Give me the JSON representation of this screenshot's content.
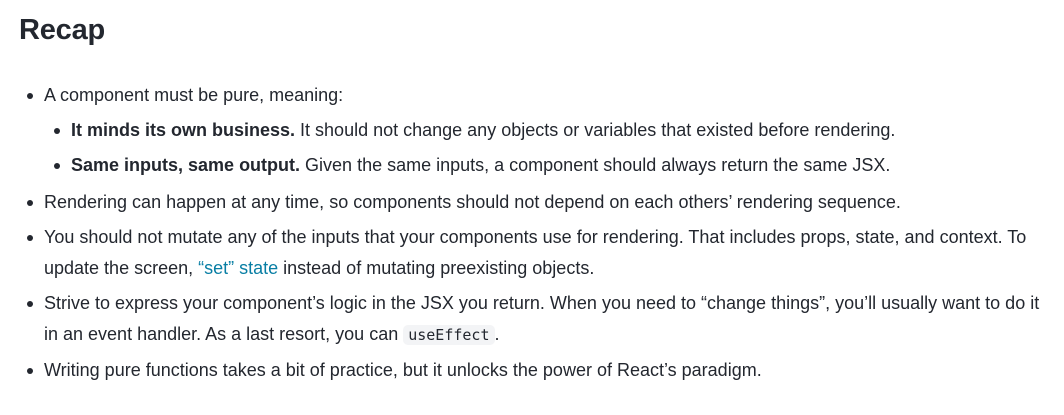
{
  "heading": "Recap",
  "items": {
    "pure": {
      "text": "A component must be pure, meaning:",
      "sub": {
        "business": {
          "bold": "It minds its own business.",
          "rest": " It should not change any objects or variables that existed before rendering."
        },
        "same": {
          "bold": "Same inputs, same output.",
          "rest": " Given the same inputs, a component should always return the same JSX."
        }
      }
    },
    "anytime": {
      "text": "Rendering can happen at any time, so components should not depend on each others’ rendering sequence."
    },
    "mutate": {
      "before": "You should not mutate any of the inputs that your components use for rendering. That includes props, state, and context. To update the screen, ",
      "link": "“set” state",
      "after": " instead of mutating preexisting objects."
    },
    "logic": {
      "before": "Strive to express your component’s logic in the JSX you return. When you need to “change things”, you’ll usually want to do it in an event handler. As a last resort, you can ",
      "code": "useEffect",
      "after": "."
    },
    "practice": {
      "text": "Writing pure functions takes a bit of practice, but it unlocks the power of React’s paradigm."
    }
  },
  "colors": {
    "text": "#23272f",
    "link": "#087ea4",
    "code_bg": "#f3f4f6"
  }
}
